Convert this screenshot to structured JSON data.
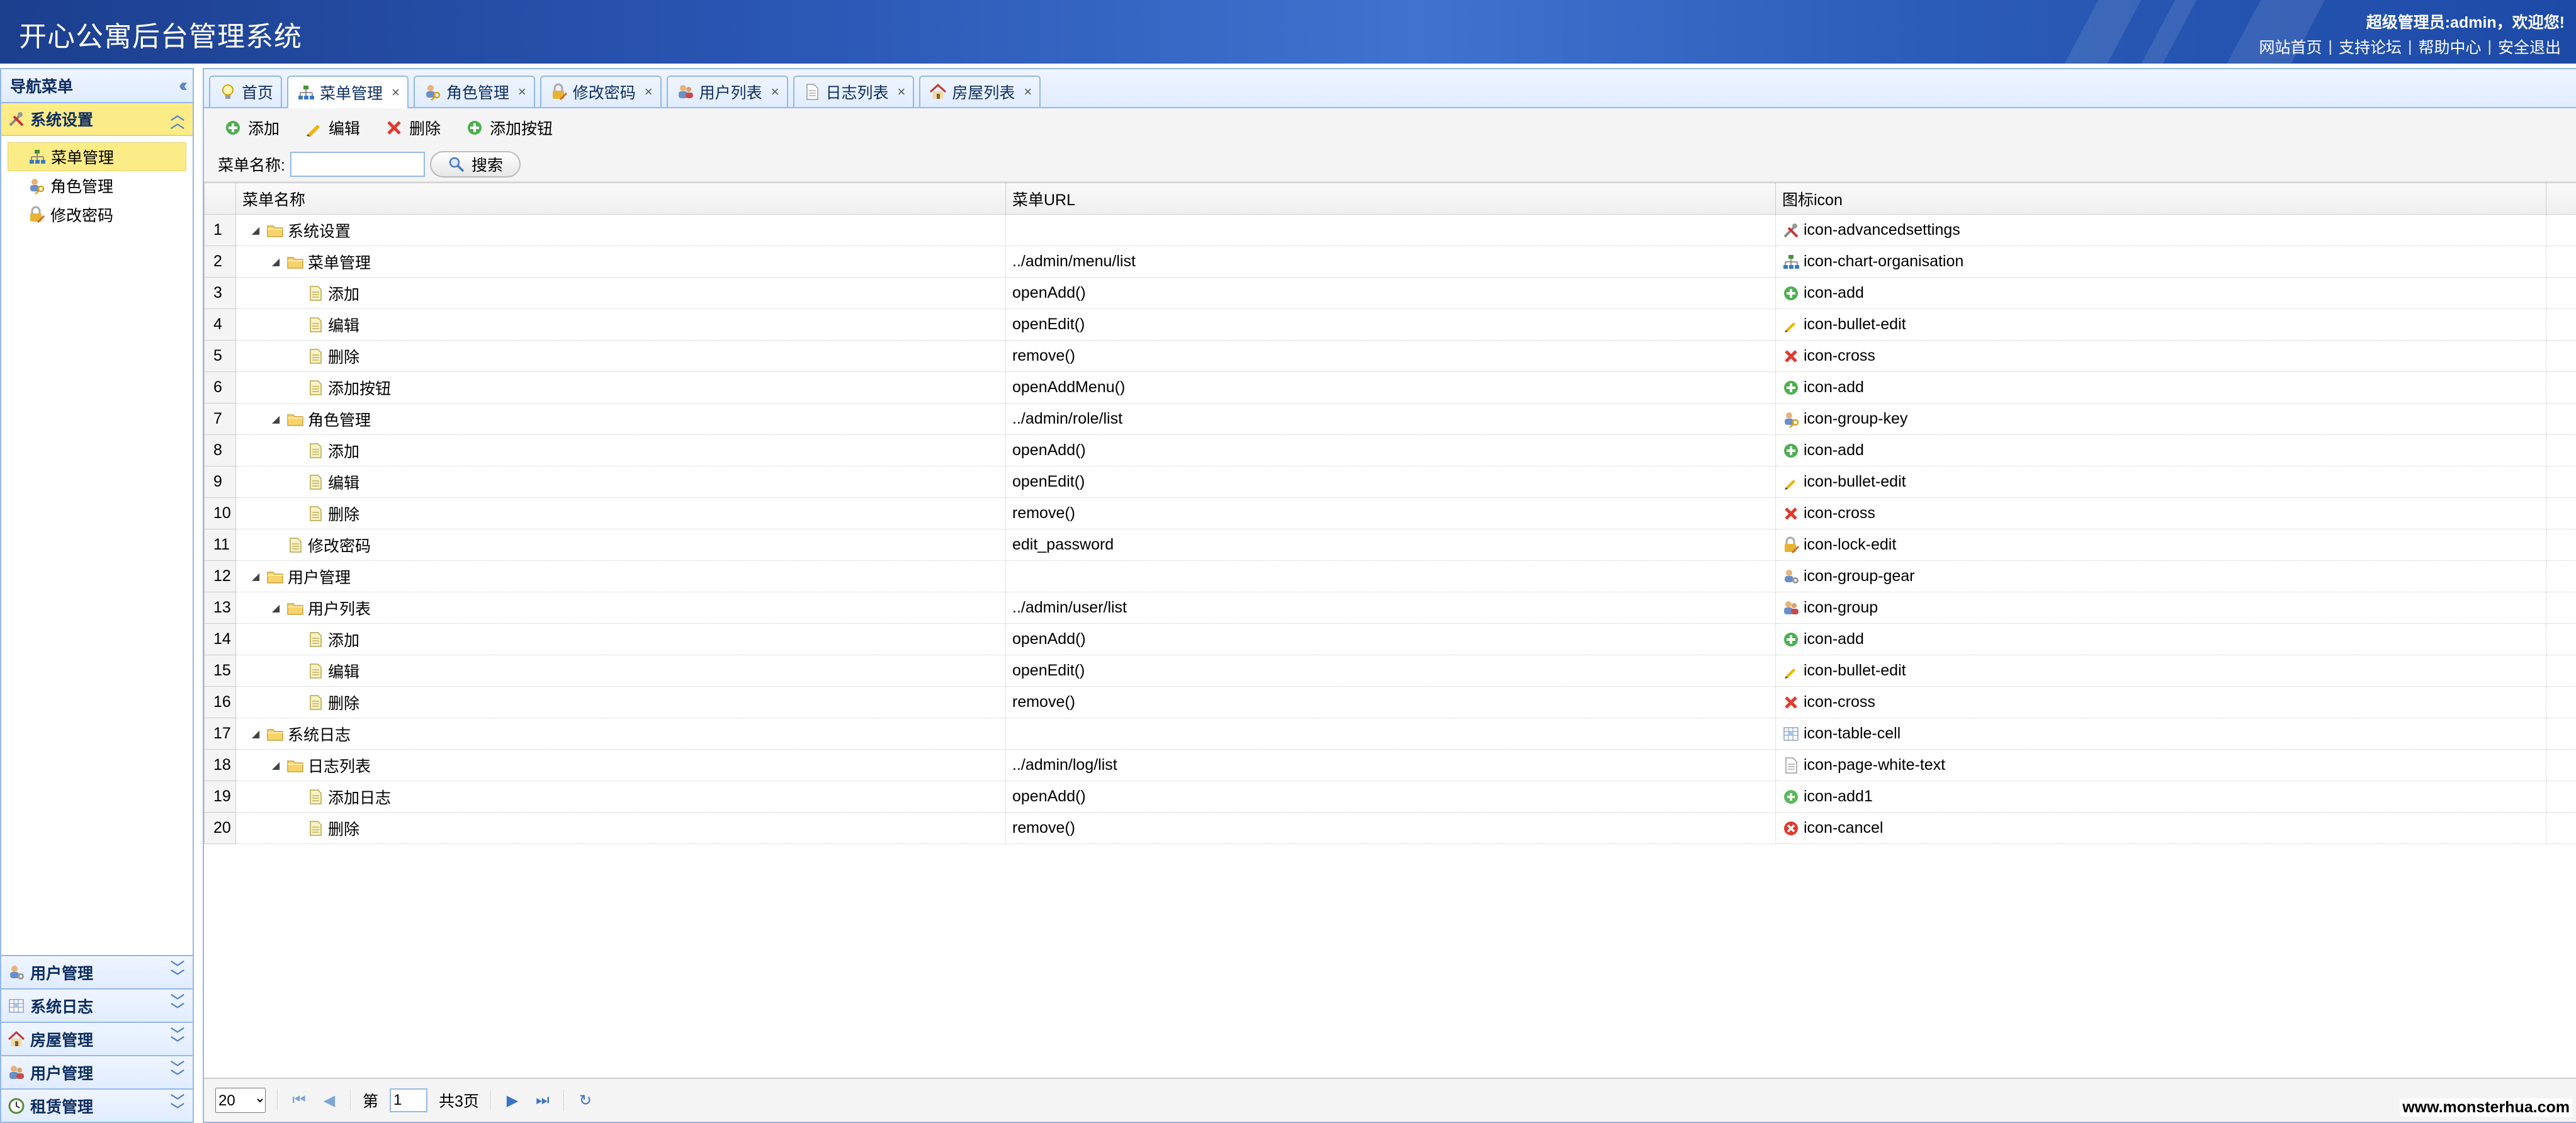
{
  "header": {
    "app_title": "开心公寓后台管理系统",
    "welcome": "超级管理员:admin，欢迎您!",
    "links": [
      "网站首页",
      "支持论坛",
      "帮助中心",
      "安全退出"
    ]
  },
  "sidebar": {
    "title": "导航菜单",
    "open_group": {
      "label": "系统设置",
      "icon": "tools-icon"
    },
    "items": [
      {
        "label": "菜单管理",
        "icon": "chart-organisation-icon",
        "selected": true
      },
      {
        "label": "角色管理",
        "icon": "group-key-icon",
        "selected": false
      },
      {
        "label": "修改密码",
        "icon": "lock-edit-icon",
        "selected": false
      }
    ],
    "collapsed_groups": [
      {
        "label": "用户管理",
        "icon": "group-gear-icon"
      },
      {
        "label": "系统日志",
        "icon": "table-cell-icon"
      },
      {
        "label": "房屋管理",
        "icon": "house-icon"
      },
      {
        "label": "用户管理",
        "icon": "group-icon"
      },
      {
        "label": "租赁管理",
        "icon": "clock-icon"
      }
    ]
  },
  "tabs": [
    {
      "label": "首页",
      "icon": "bulb-icon",
      "closable": false,
      "active": false
    },
    {
      "label": "菜单管理",
      "icon": "chart-organisation-icon",
      "closable": true,
      "active": true
    },
    {
      "label": "角色管理",
      "icon": "group-key-icon",
      "closable": true,
      "active": false
    },
    {
      "label": "修改密码",
      "icon": "lock-edit-icon",
      "closable": true,
      "active": false
    },
    {
      "label": "用户列表",
      "icon": "group-icon",
      "closable": true,
      "active": false
    },
    {
      "label": "日志列表",
      "icon": "page-white-text-icon",
      "closable": true,
      "active": false
    },
    {
      "label": "房屋列表",
      "icon": "house-icon",
      "closable": true,
      "active": false
    }
  ],
  "toolbar": {
    "add": "添加",
    "edit": "编辑",
    "delete": "删除",
    "add_button": "添加按钮"
  },
  "search": {
    "label": "菜单名称:",
    "value": "",
    "button": "搜索"
  },
  "grid": {
    "columns": [
      "菜单名称",
      "菜单URL",
      "图标icon"
    ],
    "rows": [
      {
        "n": "1",
        "level": 0,
        "folder": true,
        "expanded": true,
        "name": "系统设置",
        "url": "",
        "icon": "icon-advancedsettings"
      },
      {
        "n": "2",
        "level": 1,
        "folder": true,
        "expanded": true,
        "name": "菜单管理",
        "url": "../admin/menu/list",
        "icon": "icon-chart-organisation"
      },
      {
        "n": "3",
        "level": 2,
        "folder": false,
        "expanded": false,
        "name": "添加",
        "url": "openAdd()",
        "icon": "icon-add"
      },
      {
        "n": "4",
        "level": 2,
        "folder": false,
        "expanded": false,
        "name": "编辑",
        "url": "openEdit()",
        "icon": "icon-bullet-edit"
      },
      {
        "n": "5",
        "level": 2,
        "folder": false,
        "expanded": false,
        "name": "删除",
        "url": "remove()",
        "icon": "icon-cross"
      },
      {
        "n": "6",
        "level": 2,
        "folder": false,
        "expanded": false,
        "name": "添加按钮",
        "url": "openAddMenu()",
        "icon": "icon-add"
      },
      {
        "n": "7",
        "level": 1,
        "folder": true,
        "expanded": true,
        "name": "角色管理",
        "url": "../admin/role/list",
        "icon": "icon-group-key"
      },
      {
        "n": "8",
        "level": 2,
        "folder": false,
        "expanded": false,
        "name": "添加",
        "url": "openAdd()",
        "icon": "icon-add"
      },
      {
        "n": "9",
        "level": 2,
        "folder": false,
        "expanded": false,
        "name": "编辑",
        "url": "openEdit()",
        "icon": "icon-bullet-edit"
      },
      {
        "n": "10",
        "level": 2,
        "folder": false,
        "expanded": false,
        "name": "删除",
        "url": "remove()",
        "icon": "icon-cross"
      },
      {
        "n": "11",
        "level": 1,
        "folder": false,
        "expanded": false,
        "name": "修改密码",
        "url": "edit_password",
        "icon": "icon-lock-edit"
      },
      {
        "n": "12",
        "level": 0,
        "folder": true,
        "expanded": true,
        "name": "用户管理",
        "url": "",
        "icon": "icon-group-gear"
      },
      {
        "n": "13",
        "level": 1,
        "folder": true,
        "expanded": true,
        "name": "用户列表",
        "url": "../admin/user/list",
        "icon": "icon-group"
      },
      {
        "n": "14",
        "level": 2,
        "folder": false,
        "expanded": false,
        "name": "添加",
        "url": "openAdd()",
        "icon": "icon-add"
      },
      {
        "n": "15",
        "level": 2,
        "folder": false,
        "expanded": false,
        "name": "编辑",
        "url": "openEdit()",
        "icon": "icon-bullet-edit"
      },
      {
        "n": "16",
        "level": 2,
        "folder": false,
        "expanded": false,
        "name": "删除",
        "url": "remove()",
        "icon": "icon-cross"
      },
      {
        "n": "17",
        "level": 0,
        "folder": true,
        "expanded": true,
        "name": "系统日志",
        "url": "",
        "icon": "icon-table-cell"
      },
      {
        "n": "18",
        "level": 1,
        "folder": true,
        "expanded": true,
        "name": "日志列表",
        "url": "../admin/log/list",
        "icon": "icon-page-white-text"
      },
      {
        "n": "19",
        "level": 2,
        "folder": false,
        "expanded": false,
        "name": "添加日志",
        "url": "openAdd()",
        "icon": "icon-add1"
      },
      {
        "n": "20",
        "level": 2,
        "folder": false,
        "expanded": false,
        "name": "删除",
        "url": "remove()",
        "icon": "icon-cancel"
      }
    ]
  },
  "pager": {
    "page_size": "20",
    "page_prefix": "第",
    "current_page": "1",
    "total": "共3页"
  },
  "watermark": "www.monsterhua.com",
  "colors": {
    "header_blue": "#2a56b4",
    "panel_border": "#95b8e7",
    "selected_yellow": "#fbec88"
  }
}
